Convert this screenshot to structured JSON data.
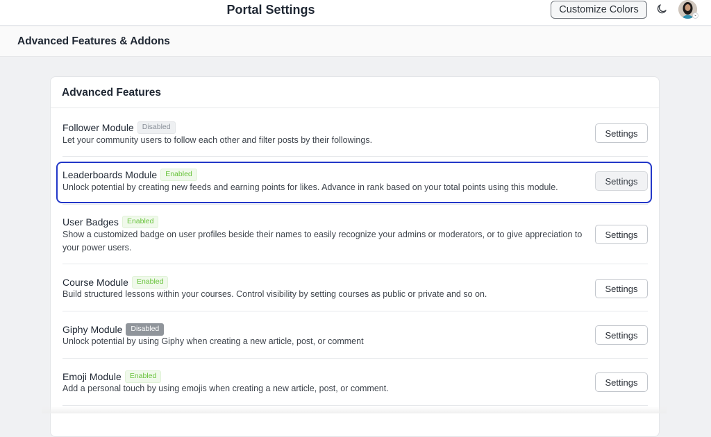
{
  "topbar": {
    "title": "Portal Settings",
    "customize_label": "Customize Colors",
    "theme_icon": "moon-icon",
    "avatar_icon": "user-avatar"
  },
  "subheader": {
    "title": "Advanced Features & Addons"
  },
  "card": {
    "title": "Advanced Features",
    "modules": [
      {
        "name": "Follower Module",
        "status": "Disabled",
        "description": "Let your community users to follow each other and filter posts by their followings.",
        "button": "Settings"
      },
      {
        "name": "Leaderboards Module",
        "status": "Enabled",
        "description": "Unlock potential by creating new feeds and earning points for likes. Advance in rank based on your total points using this module.",
        "button": "Settings"
      },
      {
        "name": "User Badges",
        "status": "Enabled",
        "description": "Show a customized badge on user profiles beside their names to easily recognize your admins or moderators, or to give appreciation to your power users.",
        "button": "Settings"
      },
      {
        "name": "Course Module",
        "status": "Enabled",
        "description": "Build structured lessons within your courses. Control visibility by setting courses as public or private and so on.",
        "button": "Settings"
      },
      {
        "name": "Giphy Module",
        "status": "Disabled",
        "description": "Unlock potential by using Giphy when creating a new article, post, or comment",
        "button": "Settings"
      },
      {
        "name": "Emoji Module",
        "status": "Enabled",
        "description": "Add a personal touch by using emojis when creating a new article, post, or comment.",
        "button": "Settings"
      }
    ]
  },
  "colors": {
    "enabled": "#67c23a",
    "disabled": "#8a9099",
    "focus_ring": "#2237c8"
  }
}
